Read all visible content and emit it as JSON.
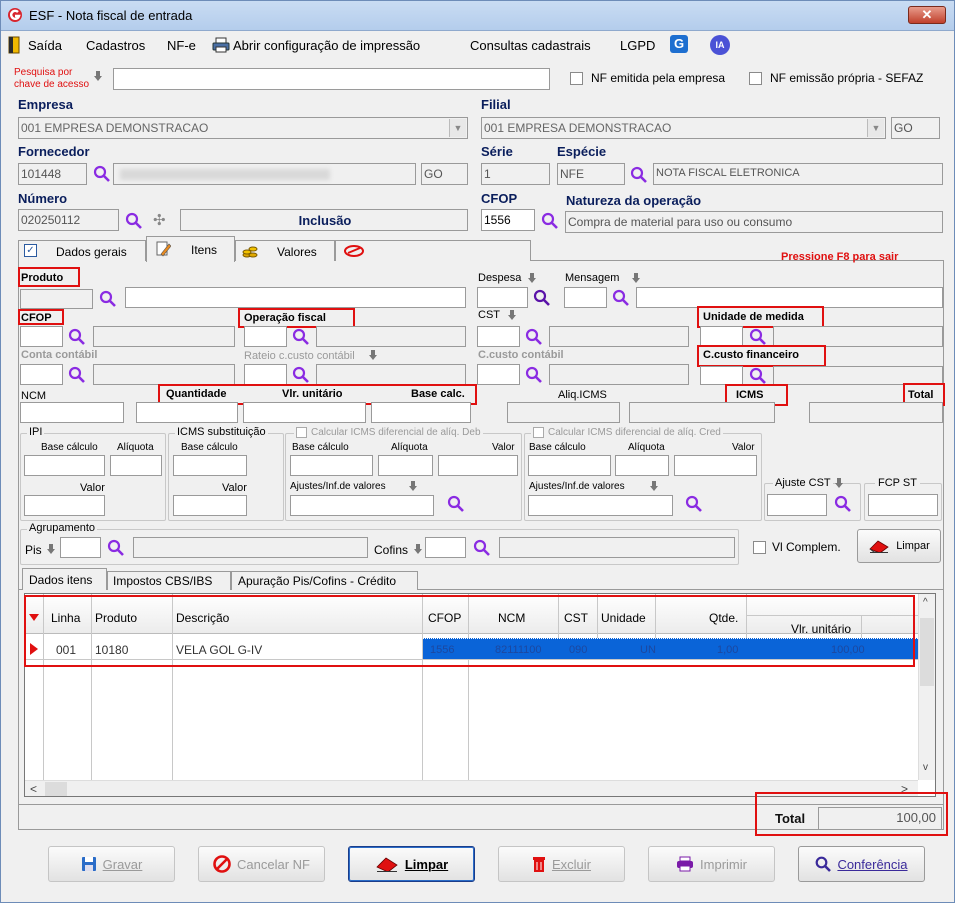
{
  "window": {
    "title": "ESF - Nota fiscal de entrada",
    "close": "x"
  },
  "menu": [
    "Saída",
    "Cadastros",
    "NF-e",
    "Abrir configuração de impressão",
    "Consultas cadastrais",
    "LGPD"
  ],
  "search": {
    "label1": "Pesquisa por",
    "label2": "chave de acesso",
    "value": ""
  },
  "checks": {
    "nf_empresa": "NF emitida pela empresa",
    "nf_propria": "NF emissão própria - SEFAZ",
    "vl_complem": "Vl Complem."
  },
  "empresa": {
    "label": "Empresa",
    "value": "001 EMPRESA DEMONSTRACAO"
  },
  "filial": {
    "label": "Filial",
    "value": "001 EMPRESA DEMONSTRACAO",
    "uf": "GO"
  },
  "fornecedor": {
    "label": "Fornecedor",
    "code": "101448",
    "uf": "GO"
  },
  "serie": {
    "label": "Série",
    "value": "1"
  },
  "especie": {
    "label": "Espécie",
    "code": "NFE",
    "desc": "NOTA FISCAL ELETRONICA"
  },
  "numero": {
    "label": "Número",
    "value": "020250112",
    "status": "Inclusão"
  },
  "cfop": {
    "label": "CFOP",
    "value": "1556"
  },
  "natureza": {
    "label": "Natureza da operação",
    "value": "Compra de material para uso ou consumo"
  },
  "tabs": {
    "dados_gerais": "Dados gerais",
    "itens": "Itens",
    "valores": "Valores"
  },
  "f8_hint": "Pressione F8 para sair",
  "item": {
    "produto": "Produto",
    "despesa": "Despesa",
    "mensagem": "Mensagem",
    "cfop": "CFOP",
    "operacao_fiscal": "Operação fiscal",
    "cst": "CST",
    "unidade": "Unidade de medida",
    "conta_contabil": "Conta contábil",
    "rateio": "Rateio c.custo contábil",
    "ccusto_contabil": "C.custo contábil",
    "ccusto_financeiro": "C.custo financeiro",
    "ncm": "NCM",
    "quantidade": "Quantidade",
    "vlr_unitario": "Vlr. unitário",
    "base_calc": "Base calc.",
    "aliq_icms": "Aliq.ICMS",
    "icms": "ICMS",
    "total": "Total"
  },
  "ipi": {
    "title": "IPI",
    "base": "Base cálculo",
    "aliq": "Alíquota",
    "valor": "Valor"
  },
  "icmsst": {
    "title": "ICMS substituição",
    "base": "Base cálculo",
    "valor": "Valor"
  },
  "difal_deb": {
    "title": "Calcular ICMS diferencial de alíq. Deb",
    "base": "Base cálculo",
    "aliq": "Alíquota",
    "valor": "Valor",
    "ajustes": "Ajustes/Inf.de valores"
  },
  "difal_cred": {
    "title": "Calcular ICMS diferencial de alíq. Cred",
    "base": "Base cálculo",
    "aliq": "Alíquota",
    "valor": "Valor",
    "ajustes": "Ajustes/Inf.de valores"
  },
  "ajuste_cst": "Ajuste CST",
  "fcp_st": "FCP ST",
  "agrupamento": {
    "title": "Agrupamento",
    "pis": "Pis",
    "cofins": "Cofins"
  },
  "limpar_small": "Limpar",
  "subtabs": [
    "Dados itens",
    "Impostos CBS/IBS",
    "Apuração Pis/Cofins - Crédito"
  ],
  "grid": {
    "headers": [
      "Linha",
      "Produto",
      "Descrição",
      "CFOP",
      "NCM",
      "CST",
      "Unidade",
      "Qtde.",
      "Vlr. unitário"
    ],
    "rows": [
      [
        "001",
        "10180",
        "VELA GOL G-IV",
        "1556",
        "82111100",
        "090",
        "UN",
        "1,00",
        "100,00"
      ]
    ]
  },
  "total": {
    "label": "Total",
    "value": "100,00"
  },
  "buttons": {
    "gravar": "Gravar",
    "cancelar": "Cancelar NF",
    "limpar": "Limpar",
    "excluir": "Excluir",
    "imprimir": "Imprimir",
    "conferencia": "Conferência"
  },
  "colors": {
    "highlight_red": "#e01010",
    "label_navy": "#0a1e5c",
    "selection": "#0a64d8",
    "magnifier": "#8a2be2"
  }
}
